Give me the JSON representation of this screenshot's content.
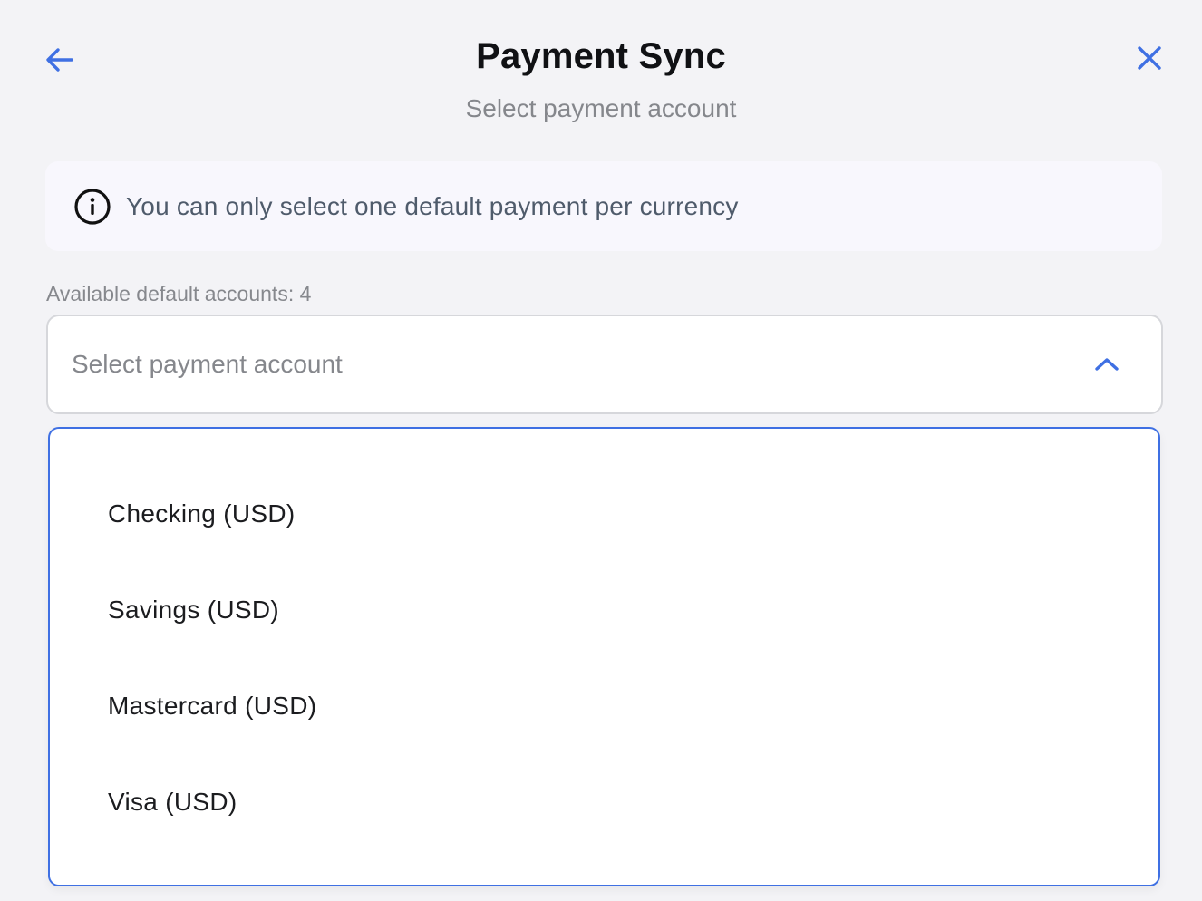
{
  "header": {
    "title": "Payment Sync",
    "subtitle": "Select payment account",
    "back_icon": "arrow-left-icon",
    "close_icon": "close-icon"
  },
  "info_banner": {
    "icon": "info-icon",
    "text": "You can only select one default payment per currency"
  },
  "account_select": {
    "available_label": "Available default accounts: 4",
    "placeholder": "Select payment account",
    "expanded": true,
    "chevron_icon": "chevron-up-icon",
    "options": [
      {
        "label": "Checking (USD)"
      },
      {
        "label": "Savings (USD)"
      },
      {
        "label": "Mastercard (USD)"
      },
      {
        "label": "Visa (USD)"
      }
    ]
  },
  "colors": {
    "accent": "#3f70e3",
    "background": "#f3f3f6",
    "banner_bg": "#f8f7fd",
    "muted_text": "#85878c"
  }
}
